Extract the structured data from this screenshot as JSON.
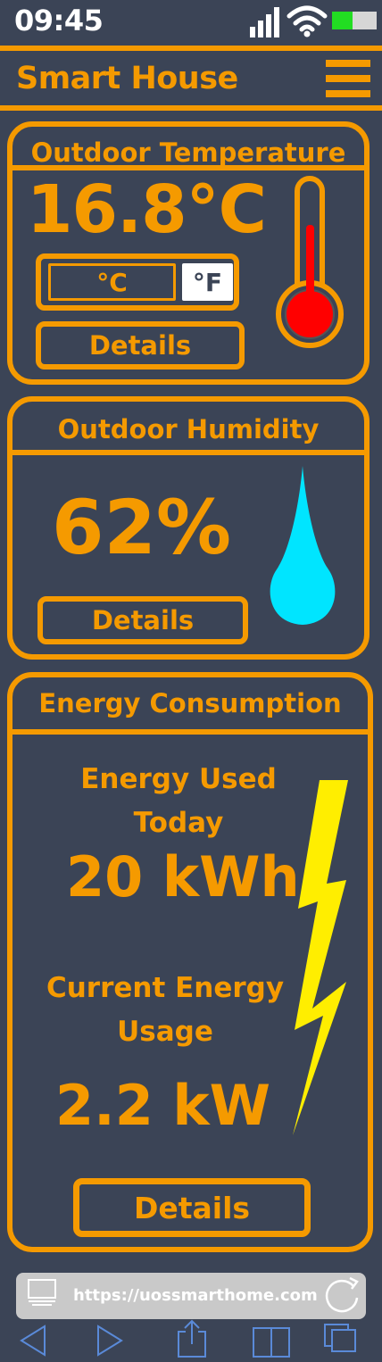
{
  "status_bar": {
    "time": "09:45",
    "battery_level": 0.45,
    "battery_color": "#22dd22",
    "icons": [
      "signal-icon",
      "wifi-icon",
      "battery-icon"
    ]
  },
  "header": {
    "title": "Smart House",
    "menu_icon": "hamburger-menu-icon"
  },
  "temperature": {
    "title": "Outdoor Temperature",
    "value": "16.8°C",
    "unit_celsius": "°C",
    "unit_fahrenheit": "°F",
    "selected_unit": "°F",
    "details_label": "Details",
    "icon": "thermometer-icon"
  },
  "humidity": {
    "title": "Outdoor Humidity",
    "value": "62%",
    "details_label": "Details",
    "icon": "water-drop-icon",
    "drop_color": "#00e5ff"
  },
  "energy": {
    "title": "Energy Consumption",
    "used_today_label": "Energy Used Today",
    "used_today_value": "20 kWh",
    "current_label": "Current Energy Usage",
    "current_value": "2.2 kW",
    "details_label": "Details",
    "icon": "lightning-bolt-icon",
    "bolt_color": "#ffee00"
  },
  "browser": {
    "url": "https://uossmarthome.com",
    "icons": [
      "desktop-icon",
      "reload-icon",
      "back-icon",
      "forward-icon",
      "share-icon",
      "book-icon",
      "tabs-icon"
    ]
  },
  "colors": {
    "background": "#3b4456",
    "accent": "#f59a00"
  }
}
